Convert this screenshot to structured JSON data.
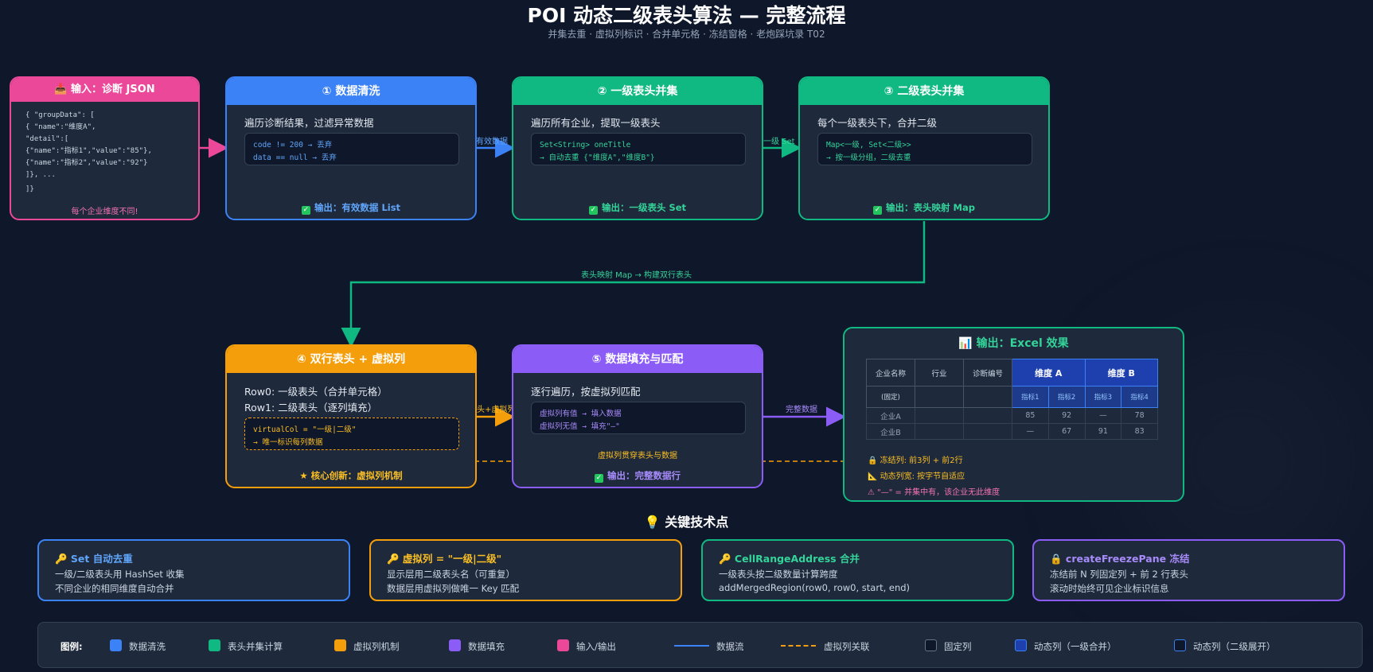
{
  "header": {
    "title": "POI 动态二级表头算法 — 完整流程",
    "subtitle": "并集去重 · 虚拟列标识 · 合并单元格 · 冻结窗格 · 老炮踩坑录 T02"
  },
  "input": {
    "title": "📥 输入：诊断 JSON",
    "lines": [
      "{ \"groupData\": [",
      "{ \"name\":\"维度A\",",
      "\"detail\":[",
      "{\"name\":\"指标1\",\"value\":\"85\"},",
      "{\"name\":\"指标2\",\"value\":\"92\"}",
      "]}, ...",
      "]}"
    ],
    "note": "每个企业维度不同!"
  },
  "step1": {
    "title": "① 数据清洗",
    "desc": "遍历诊断结果，过滤异常数据",
    "code": [
      "code != 200 → 丢弃",
      "data == null → 丢弃"
    ],
    "output": "输出：有效数据 List"
  },
  "step2": {
    "title": "② 一级表头并集",
    "desc": "遍历所有企业，提取一级表头",
    "code": [
      "Set<String> oneTitle",
      "→ 自动去重 {\"维度A\",\"维度B\"}"
    ],
    "output": "输出：一级表头 Set"
  },
  "step3": {
    "title": "③ 二级表头并集",
    "desc": "每个一级表头下，合并二级",
    "code": [
      "Map<一级, Set<二级>>",
      "→ 按一级分组，二级去重"
    ],
    "output": "输出：表头映射 Map"
  },
  "step4": {
    "title": "④ 双行表头 + 虚拟列",
    "desc1": "Row0: 一级表头（合并单元格）",
    "desc2": "Row1: 二级表头（逐列填充）",
    "code": [
      "virtualCol = \"一级|二级\"",
      "→ 唯一标识每列数据"
    ],
    "output": "核心创新：虚拟列机制"
  },
  "step5": {
    "title": "⑤ 数据填充与匹配",
    "desc": "逐行遍历，按虚拟列匹配",
    "code": [
      "虚拟列有值 → 填入数据",
      "虚拟列无值 → 填充\"—\""
    ],
    "note": "虚拟列贯穿表头与数据",
    "output": "输出：完整数据行"
  },
  "arrows": {
    "a1": "有效数据",
    "a2": "一级 Set",
    "a3": "表头映射 Map → 构建双行表头",
    "a4": "表头+虚拟列",
    "a5": "完整数据"
  },
  "excel": {
    "title": "📊 输出：Excel 效果",
    "fixed": [
      "企业名称",
      "行业",
      "诊断编号"
    ],
    "fixed_note": "(固定)",
    "dims": [
      "维度 A",
      "维度 B"
    ],
    "metrics": [
      "指标1",
      "指标2",
      "指标3",
      "指标4"
    ],
    "rows": [
      [
        "企业A",
        "",
        "",
        "85",
        "92",
        "—",
        "78"
      ],
      [
        "企业B",
        "",
        "",
        "—",
        "67",
        "91",
        "83"
      ]
    ],
    "notes": [
      "🔒 冻结列: 前3列 + 前2行",
      "📐 动态列宽: 按字节自适应",
      "⚠ \"—\" = 并集中有，该企业无此维度"
    ]
  },
  "keypoints": {
    "title": "💡 关键技术点",
    "items": [
      {
        "title": "🔑 Set 自动去重",
        "l1": "一级/二级表头用 HashSet 收集",
        "l2": "不同企业的相同维度自动合并"
      },
      {
        "title": "🔑 虚拟列 = \"一级|二级\"",
        "l1": "显示层用二级表头名（可重复）",
        "l2": "数据层用虚拟列做唯一 Key 匹配"
      },
      {
        "title": "🔑 CellRangeAddress 合并",
        "l1": "一级表头按二级数量计算跨度",
        "l2": "addMergedRegion(row0, row0, start, end)"
      },
      {
        "title": "🔒 createFreezePane 冻结",
        "l1": "冻结前 N 列固定列 + 前 2 行表头",
        "l2": "滚动时始终可见企业标识信息"
      }
    ]
  },
  "legend": {
    "title": "图例:",
    "items": [
      "数据清洗",
      "表头并集计算",
      "虚拟列机制",
      "数据填充",
      "输入/输出",
      "数据流",
      "虚拟列关联",
      "固定列",
      "动态列（一级合并）",
      "动态列（二级展开）"
    ]
  },
  "colors": {
    "pink": "#ec4899",
    "blue": "#3b82f6",
    "green": "#10b981",
    "orange": "#f59e0b",
    "purple": "#8b5cf6",
    "navy": "#1e40af"
  }
}
